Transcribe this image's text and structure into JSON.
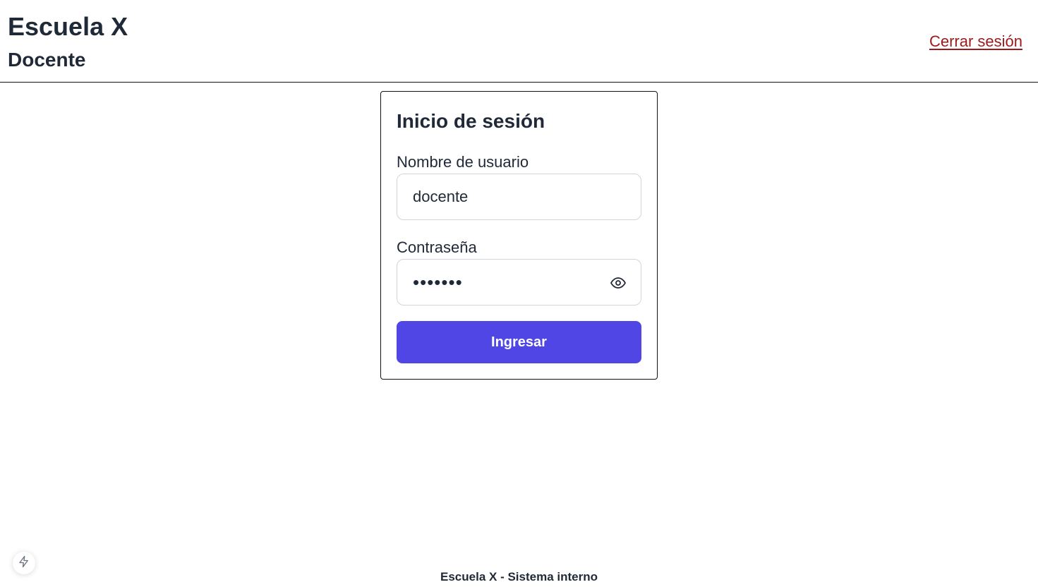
{
  "header": {
    "title": "Escuela X",
    "subtitle": "Docente",
    "logout_label": "Cerrar sesión"
  },
  "login": {
    "title": "Inicio de sesión",
    "username_label": "Nombre de usuario",
    "username_value": "docente",
    "password_label": "Contraseña",
    "password_value": "•••••••",
    "password_toggle_icon": "eye-icon",
    "submit_label": "Ingresar"
  },
  "footer": {
    "text": "Escuela X - Sistema interno"
  },
  "badge": {
    "icon": "lightning-icon"
  },
  "colors": {
    "primary": "#4f46e5",
    "logout": "#991b1b",
    "text": "#1f2937"
  }
}
